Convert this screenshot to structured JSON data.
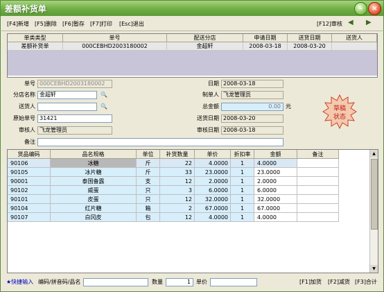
{
  "window": {
    "title": "差额补货单"
  },
  "toolbar": {
    "cmd1": "[F4]新增",
    "cmd2": "[F5]删除",
    "cmd3": "[F6]暂存",
    "cmd4": "[F7]打印",
    "cmd5": "[Esc]退出",
    "review": "[F12]审核"
  },
  "header_grid": {
    "columns": [
      "单类类型",
      "单号",
      "配送分店",
      "申请日期",
      "送货日期",
      "送货人"
    ],
    "row": [
      "差额补货单",
      "000CEBHD2003180002",
      "金超轩",
      "2008-03-18",
      "2008-03-20",
      ""
    ]
  },
  "form": {
    "order_no_label": "单号",
    "order_no": "000CEBHD2003180002",
    "store_label": "分店名称",
    "store": "金超轩",
    "sender_label": "送货人",
    "sender": "",
    "orig_no_label": "原始单号",
    "orig_no": "31421",
    "reviewer_label": "审核人",
    "reviewer": "飞龙管理员",
    "note_label": "备注",
    "note": "",
    "date_label": "日期",
    "date": "2008-03-18",
    "maker_label": "制单人",
    "maker": "飞龙管理员",
    "total_label": "总金额",
    "total": "0.00",
    "total_unit": "元",
    "delivery_date_label": "送货日期",
    "delivery_date": "2008-03-20",
    "review_date_label": "审核日期",
    "review_date": "2008-03-18",
    "stamp_line1": "草稿",
    "stamp_line2": "状态"
  },
  "detail_grid": {
    "columns": [
      "货品编码",
      "品名规格",
      "单位",
      "补货数量",
      "单价",
      "折扣率",
      "金额",
      "备注"
    ],
    "rows": [
      [
        "90106",
        "冰糖",
        "斤",
        "22",
        "4.0000",
        "1",
        "4.0000",
        ""
      ],
      [
        "90105",
        "冰片糖",
        "斤",
        "33",
        "23.0000",
        "1",
        "23.0000",
        ""
      ],
      [
        "90001",
        "泰国备露",
        "支",
        "12",
        "2.0000",
        "1",
        "2.0000",
        ""
      ],
      [
        "90102",
        "威蛋",
        "只",
        "3",
        "6.0000",
        "1",
        "6.0000",
        ""
      ],
      [
        "90101",
        "皮蛋",
        "只",
        "12",
        "32.0000",
        "1",
        "32.0000",
        ""
      ],
      [
        "90104",
        "红片糖",
        "箱",
        "2",
        "67.0000",
        "1",
        "67.0000",
        ""
      ],
      [
        "90107",
        "白冈皮",
        "包",
        "12",
        "4.0000",
        "1",
        "4.0000",
        ""
      ]
    ]
  },
  "footer": {
    "quick_input": "★快捷输入",
    "quick_hint": "编码/拼音码/品名",
    "qty_label": "数量",
    "qty_value": "1",
    "price_label": "单价",
    "price_value": "",
    "f1": "[F1]加货",
    "f2": "[F2]减货",
    "f3": "[F3]合计"
  },
  "colors": {
    "title_green": "#6fae45",
    "row_blue": "#d7eefb",
    "stamp_red": "#d04020"
  }
}
